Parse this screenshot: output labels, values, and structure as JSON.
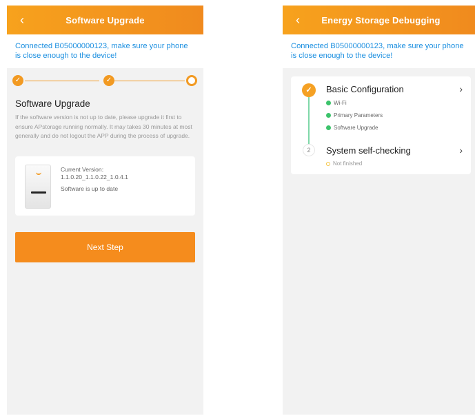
{
  "left": {
    "header": {
      "title": "Software Upgrade",
      "back_icon": "chevron-left-icon"
    },
    "notice": "Connected B05000000123, make sure your phone is close enough to the device!",
    "stepper": {
      "accent": "#f29a22",
      "steps_total": 3,
      "completed": 2,
      "current": 3
    },
    "section_title": "Software Upgrade",
    "description": "If the software version is not up to date, please upgrade it first to ensure APstorage running normally. It may takes 30 minutes at most generally and do not logout the APP during the process of upgrade.",
    "card": {
      "version_label": "Current Version:",
      "version_value": "1.1.0.20_1.1.0.22_1.0.4.1",
      "status": "Software is up to date"
    },
    "next_button": "Next Step"
  },
  "right": {
    "header": {
      "title": "Energy Storage Debugging",
      "back_icon": "chevron-left-icon"
    },
    "notice": "Connected B05000000123, make sure your phone is close enough to the device!",
    "steps": [
      {
        "number": "1",
        "title": "Basic Configuration",
        "done": true,
        "items": [
          "Wi-Fi",
          "Primary Parameters",
          "Software Upgrade"
        ]
      },
      {
        "number": "2",
        "title": "System self-checking",
        "done": false,
        "items": [
          "Not finished"
        ]
      }
    ]
  },
  "colors": {
    "brand": "#f58c1d",
    "link": "#1b8fe0",
    "success": "#3cc36b"
  }
}
